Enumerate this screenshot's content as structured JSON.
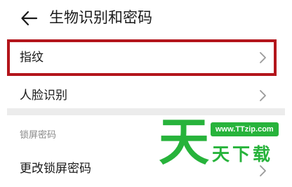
{
  "header": {
    "title": "生物识别和密码"
  },
  "rows": [
    {
      "label": "指纹"
    },
    {
      "label": "人脸识别"
    }
  ],
  "lock_section": {
    "header": "锁屏密码",
    "items": [
      {
        "label": "更改锁屏密码"
      }
    ]
  },
  "watermark": {
    "big_char": "天",
    "url": "www.TTzip.com",
    "chars": "天下载"
  },
  "colors": {
    "highlight_border": "#b3151b",
    "watermark_green": "#27b33b"
  }
}
